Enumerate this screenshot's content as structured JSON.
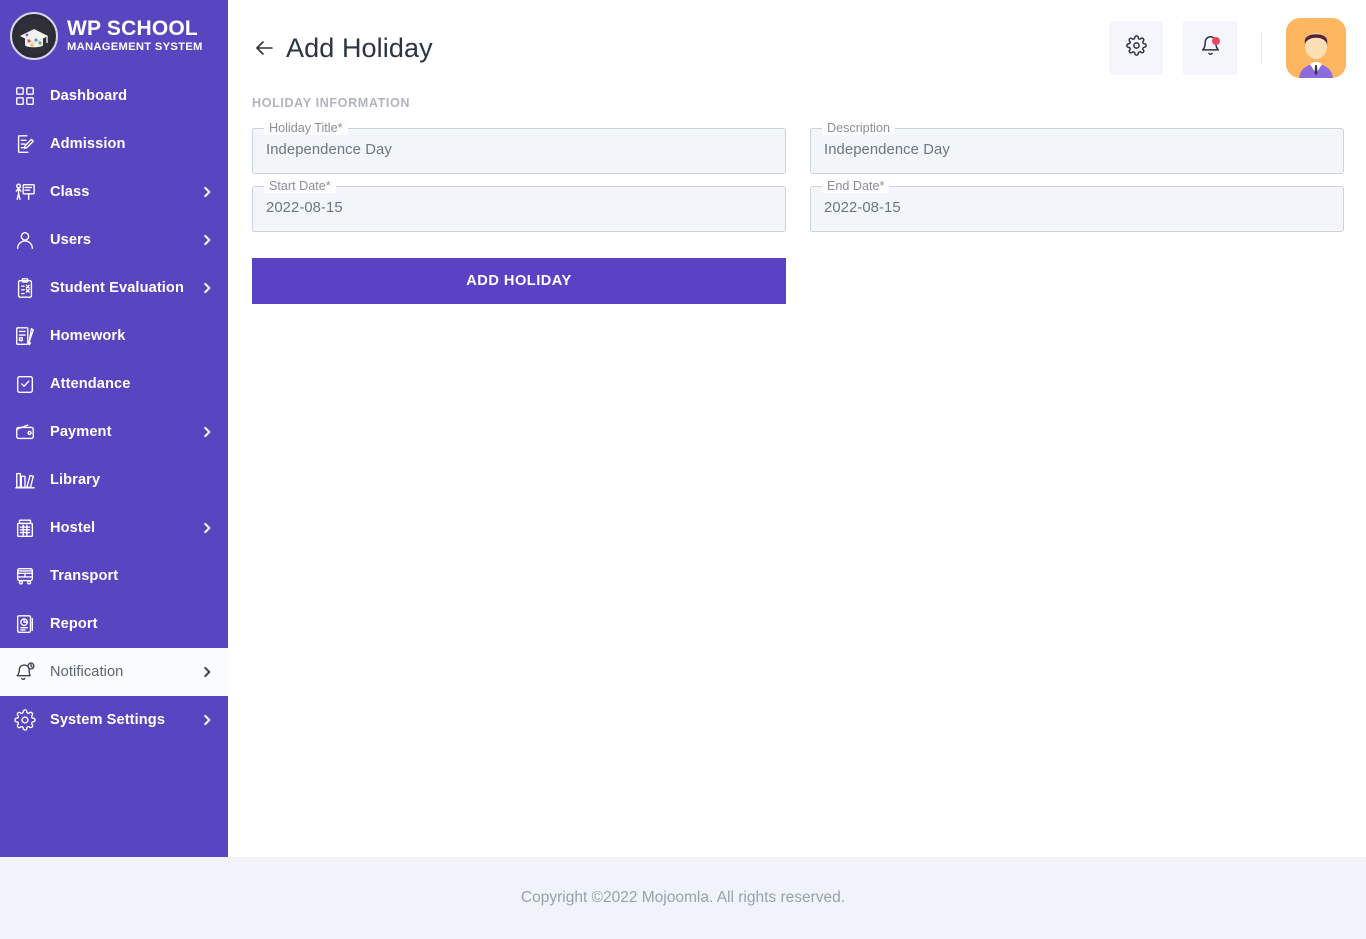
{
  "brand": {
    "title": "WP SCHOOL",
    "subtitle": "MANAGEMENT SYSTEM",
    "logo_icon": "graduation-cap-logo-icon"
  },
  "colors": {
    "sidebar_bg": "#5845c0",
    "accent": "#5a42c4",
    "active_item_bg": "#fafbfd",
    "field_bg": "#f2f5fa",
    "field_border": "#ccd2df",
    "footer_bg": "#f0f3f9",
    "notification_dot": "#f5455c",
    "avatar_bg": "#ffb661"
  },
  "sidebar": {
    "items": [
      {
        "label": "Dashboard",
        "icon": "grid-dashboard-icon",
        "has_submenu": false,
        "active": false
      },
      {
        "label": "Admission",
        "icon": "document-edit-icon",
        "has_submenu": false,
        "active": false
      },
      {
        "label": "Class",
        "icon": "teacher-board-icon",
        "has_submenu": true,
        "active": false
      },
      {
        "label": "Users",
        "icon": "user-icon",
        "has_submenu": true,
        "active": false
      },
      {
        "label": "Student Evaluation",
        "icon": "clipboard-check-icon",
        "has_submenu": true,
        "active": false
      },
      {
        "label": "Homework",
        "icon": "book-pencil-icon",
        "has_submenu": false,
        "active": false
      },
      {
        "label": "Attendance",
        "icon": "checkbox-calendar-icon",
        "has_submenu": false,
        "active": false
      },
      {
        "label": "Payment",
        "icon": "wallet-icon",
        "has_submenu": true,
        "active": false
      },
      {
        "label": "Library",
        "icon": "books-shelf-icon",
        "has_submenu": false,
        "active": false
      },
      {
        "label": "Hostel",
        "icon": "hostel-building-icon",
        "has_submenu": true,
        "active": false
      },
      {
        "label": "Transport",
        "icon": "bus-icon",
        "has_submenu": false,
        "active": false
      },
      {
        "label": "Report",
        "icon": "report-chart-icon",
        "has_submenu": false,
        "active": false
      },
      {
        "label": "Notification",
        "icon": "bell-clock-icon",
        "has_submenu": true,
        "active": true
      },
      {
        "label": "System Settings",
        "icon": "gear-icon",
        "has_submenu": true,
        "active": false
      }
    ],
    "caret_icon": "chevron-right-icon"
  },
  "topbar": {
    "back_icon": "arrow-left-icon",
    "title": "Add Holiday",
    "settings_icon": "gear-icon",
    "notifications_icon": "bell-icon",
    "has_notification_badge": true,
    "avatar_icon": "user-avatar-icon"
  },
  "content": {
    "section_label": "HOLIDAY INFORMATION",
    "fields": [
      {
        "label": "Holiday Title*",
        "value": "Independence Day"
      },
      {
        "label": "Description",
        "value": "Independence Day"
      },
      {
        "label": "Start Date*",
        "value": "2022-08-15"
      },
      {
        "label": "End Date*",
        "value": "2022-08-15"
      }
    ],
    "submit_label": "ADD HOLIDAY"
  },
  "footer": {
    "text": "Copyright ©2022 Mojoomla. All rights reserved."
  }
}
